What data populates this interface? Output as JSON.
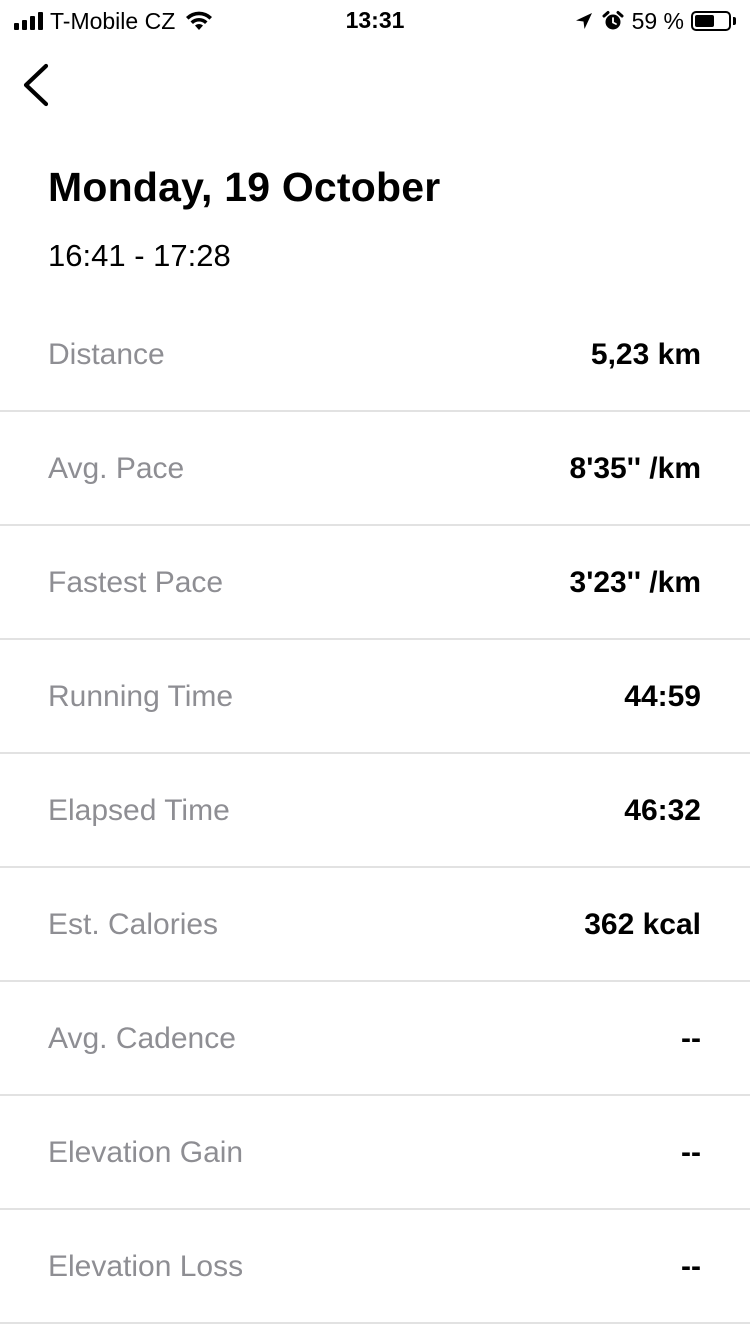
{
  "status_bar": {
    "carrier": "T-Mobile CZ",
    "time": "13:31",
    "battery_percent": "59 %",
    "battery_level": 0.59
  },
  "header": {
    "title": "Monday, 19 October",
    "time_range": "16:41 - 17:28"
  },
  "stats": [
    {
      "label": "Distance",
      "value": "5,23 km"
    },
    {
      "label": "Avg. Pace",
      "value": "8'35'' /km"
    },
    {
      "label": "Fastest Pace",
      "value": "3'23'' /km"
    },
    {
      "label": "Running Time",
      "value": "44:59"
    },
    {
      "label": "Elapsed Time",
      "value": "46:32"
    },
    {
      "label": "Est. Calories",
      "value": "362 kcal"
    },
    {
      "label": "Avg. Cadence",
      "value": "--"
    },
    {
      "label": "Elevation Gain",
      "value": "--"
    },
    {
      "label": "Elevation Loss",
      "value": "--"
    }
  ],
  "icons": {
    "back": "chevron-left-icon",
    "signal": "cellular-signal-icon",
    "wifi": "wifi-icon",
    "location": "location-arrow-icon",
    "alarm": "alarm-clock-icon",
    "battery": "battery-icon"
  },
  "colors": {
    "label_gray": "#8e8e93",
    "divider": "#e2e2e2",
    "text": "#000000",
    "background": "#ffffff"
  }
}
